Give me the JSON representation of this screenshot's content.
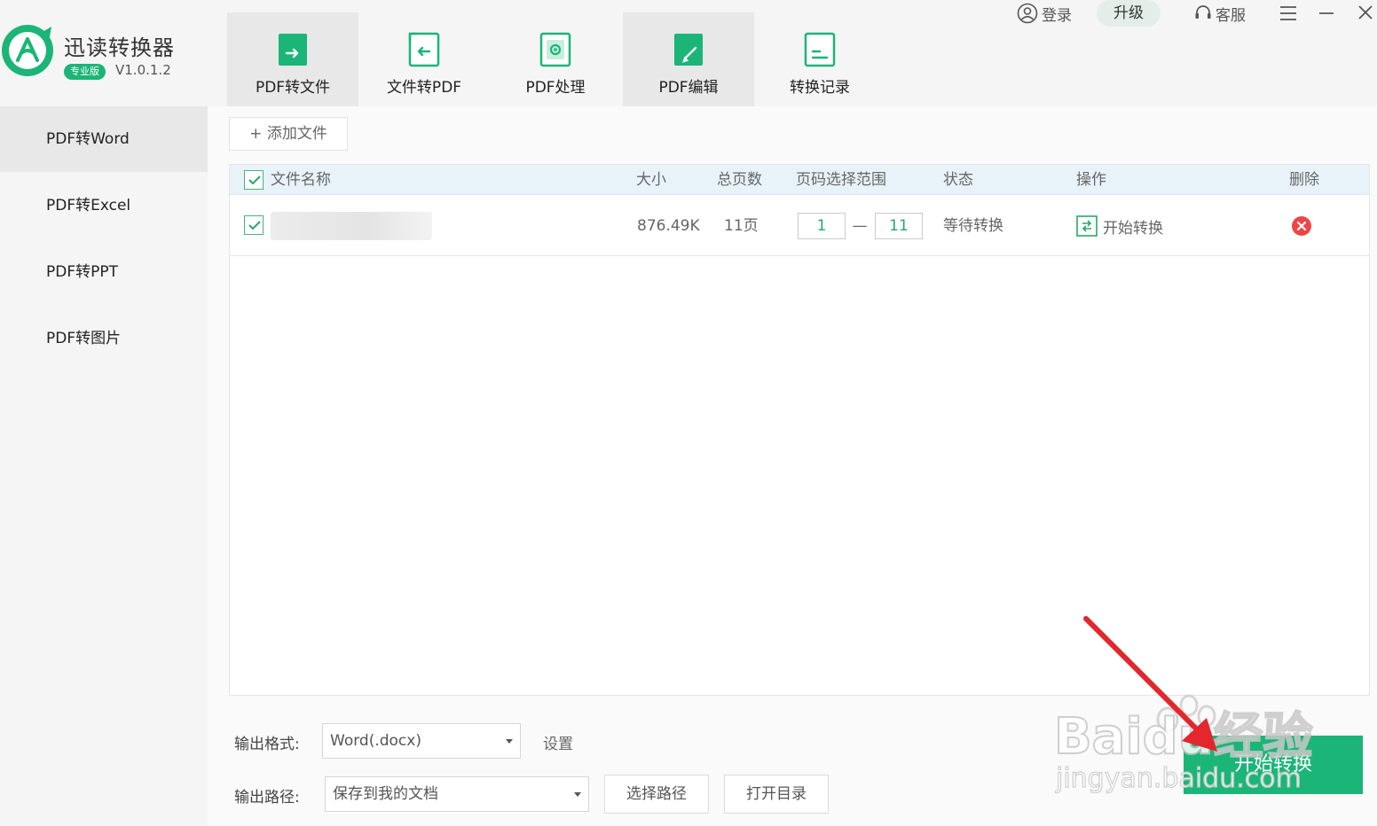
{
  "app": {
    "name": "迅读转换器",
    "edition": "专业版",
    "version": "V1.0.1.2"
  },
  "window_controls": {
    "login": "登录",
    "upgrade": "升级",
    "service": "客服"
  },
  "nav_tabs": [
    {
      "label": "PDF转文件",
      "icon": "pdf-to-file-icon",
      "active": true
    },
    {
      "label": "文件转PDF",
      "icon": "file-to-pdf-icon",
      "active": false
    },
    {
      "label": "PDF处理",
      "icon": "pdf-process-icon",
      "active": false
    },
    {
      "label": "PDF编辑",
      "icon": "pdf-edit-icon",
      "active": true
    },
    {
      "label": "转换记录",
      "icon": "conversion-history-icon",
      "active": false
    }
  ],
  "sidebar": {
    "items": [
      {
        "label": "PDF转Word",
        "active": true
      },
      {
        "label": "PDF转Excel",
        "active": false
      },
      {
        "label": "PDF转PPT",
        "active": false
      },
      {
        "label": "PDF转图片",
        "active": false
      }
    ]
  },
  "toolbar": {
    "add_file": "+ 添加文件"
  },
  "table": {
    "columns": [
      "文件名称",
      "大小",
      "总页数",
      "页码选择范围",
      "状态",
      "操作",
      "删除"
    ],
    "rows": [
      {
        "checked": true,
        "size": "876.49K",
        "pages": "11页",
        "range_from": "1",
        "range_separator": "—",
        "range_to": "11",
        "status": "等待转换",
        "action": "开始转换"
      }
    ]
  },
  "output": {
    "format_label": "输出格式:",
    "format_value": "Word(.docx)",
    "settings": "设置",
    "path_label": "输出路径:",
    "path_value": "保存到我的文档",
    "choose_path": "选择路径",
    "open_dir": "打开目录",
    "convert": "开始转换"
  },
  "watermark": {
    "brand": "Baidu经验",
    "url": "jingyan.baidu.com"
  },
  "colors": {
    "brand_green": "#1bb577",
    "header_blue": "#e8f3f9",
    "delete_red": "#ef4444",
    "arrow_red": "#e3272d"
  }
}
